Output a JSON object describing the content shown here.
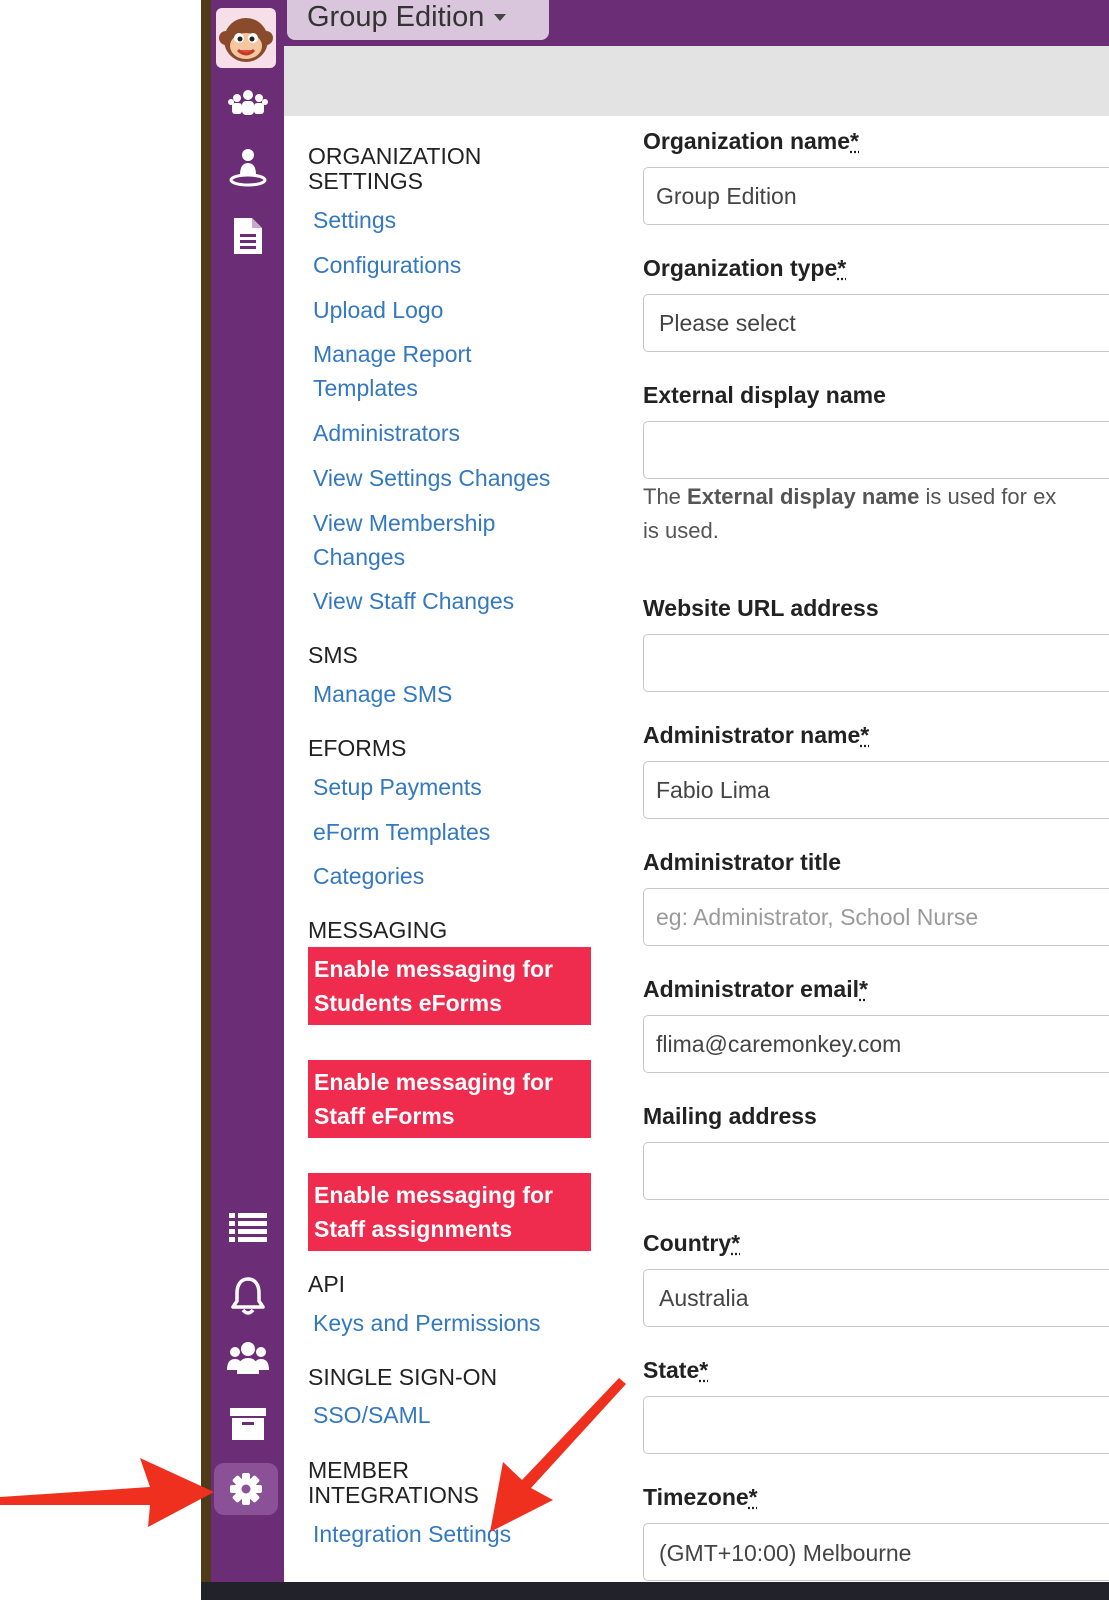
{
  "header": {
    "org_name": "Group Edition"
  },
  "rail": {
    "icons": [
      "caremonkey-logo",
      "members-icon",
      "person-icon",
      "document-icon",
      "list-icon",
      "bell-icon",
      "group-icon",
      "archive-icon",
      "gear-icon"
    ]
  },
  "nav": {
    "sections": {
      "organization": "ORGANIZATION",
      "organization_2": "SETTINGS",
      "sms": "SMS",
      "eforms": "EFORMS",
      "messaging": "MESSAGING",
      "api": "API",
      "sso": "SINGLE SIGN-ON",
      "member": "MEMBER",
      "member_2": "INTEGRATIONS"
    },
    "links": {
      "settings": "Settings",
      "configurations": "Configurations",
      "upload_logo": "Upload Logo",
      "manage_report_1": "Manage Report",
      "manage_report_2": "Templates",
      "administrators": "Administrators",
      "view_settings": "View Settings Changes",
      "view_membership_1": "View Membership",
      "view_membership_2": "Changes",
      "view_staff": "View Staff Changes",
      "manage_sms": "Manage SMS",
      "setup_payments": "Setup Payments",
      "eform_templates": "eForm Templates",
      "categories": "Categories",
      "keys_permissions": "Keys and Permissions",
      "sso_saml": "SSO/SAML",
      "integration_settings": "Integration Settings"
    },
    "messaging_buttons": {
      "students_1": "Enable messaging for",
      "students_2": "Students eForms",
      "staff_eforms_1": "Enable messaging for",
      "staff_eforms_2": "Staff eForms",
      "staff_assign_1": "Enable messaging for",
      "staff_assign_2": "Staff assignments"
    }
  },
  "form": {
    "org_name_label": "Organization name",
    "org_name_value": "Group Edition",
    "org_type_label": "Organization type",
    "org_type_value": "Please select",
    "ext_display_label": "External display name",
    "ext_help_pre": "The ",
    "ext_help_bold": "External display name",
    "ext_help_post": " is used for ex",
    "ext_help_line2": "is used.",
    "website_label": "Website URL address",
    "admin_name_label": "Administrator name",
    "admin_name_value": "Fabio Lima",
    "admin_title_label": "Administrator title",
    "admin_title_placeholder": "eg: Administrator, School Nurse",
    "admin_email_label": "Administrator email",
    "admin_email_value": "flima@caremonkey.com",
    "mailing_label": "Mailing address",
    "country_label": "Country",
    "country_value": "Australia",
    "state_label": "State",
    "timezone_label": "Timezone",
    "timezone_value": "(GMT+10:00) Melbourne",
    "required_mark": "*"
  },
  "colors": {
    "brand_purple": "#6b2d75",
    "link_blue": "#3378c0",
    "alert_red": "#ef2b4e",
    "annotation_arrow": "#f0301f"
  }
}
